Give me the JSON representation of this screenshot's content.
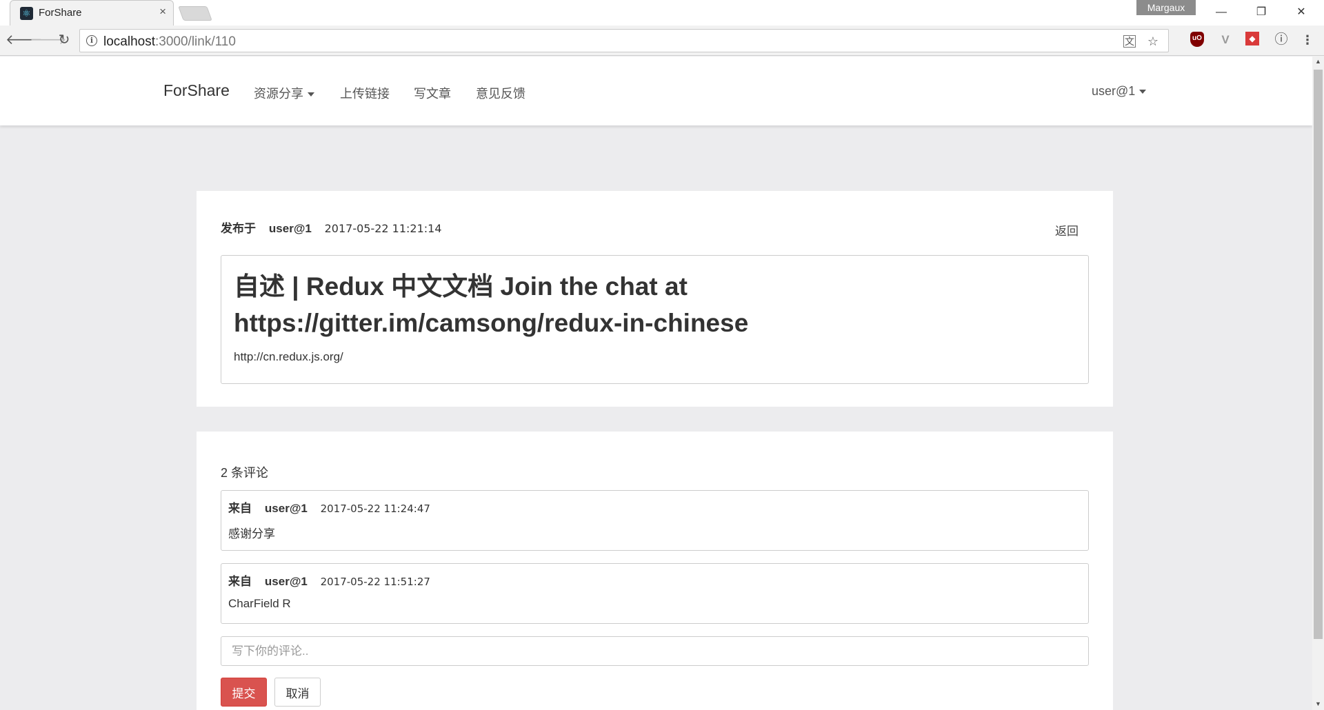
{
  "browser": {
    "tab_title": "ForShare",
    "tab_favicon": "⚛",
    "tab_close": "×",
    "profile_name": "Margaux",
    "url_host": "localhost",
    "url_path": ":3000/link/110",
    "icons": {
      "back": "🡐",
      "forward": "🡒",
      "reload": "↻",
      "translate": "文",
      "bookmark": "☆",
      "minimize": "—",
      "restore": "❐",
      "close": "✕"
    },
    "extensions": [
      "uO",
      "V",
      "◆",
      "ⓘ",
      "⋮"
    ]
  },
  "navbar": {
    "brand": "ForShare",
    "items": [
      "资源分享",
      "上传链接",
      "写文章",
      "意见反馈"
    ],
    "user": "user@1"
  },
  "post": {
    "published_label": "发布于",
    "author": "user@1",
    "time": "2017-05-22 11:21:14",
    "back_label": "返回",
    "title": "自述 | Redux 中文文档 Join the chat at https://gitter.im/camsong/redux-in-chinese",
    "url": "http://cn.redux.js.org/"
  },
  "comments": {
    "count_label": "2 条评论",
    "from_label": "来自",
    "items": [
      {
        "author": "user@1",
        "time": "2017-05-22 11:24:47",
        "body": "感谢分享"
      },
      {
        "author": "user@1",
        "time": "2017-05-22 11:51:27",
        "body": "CharField R"
      }
    ],
    "input_placeholder": "写下你的评论..",
    "submit_label": "提交",
    "cancel_label": "取消"
  },
  "colors": {
    "submit": "#d9534f",
    "page_bg": "#ececee"
  }
}
